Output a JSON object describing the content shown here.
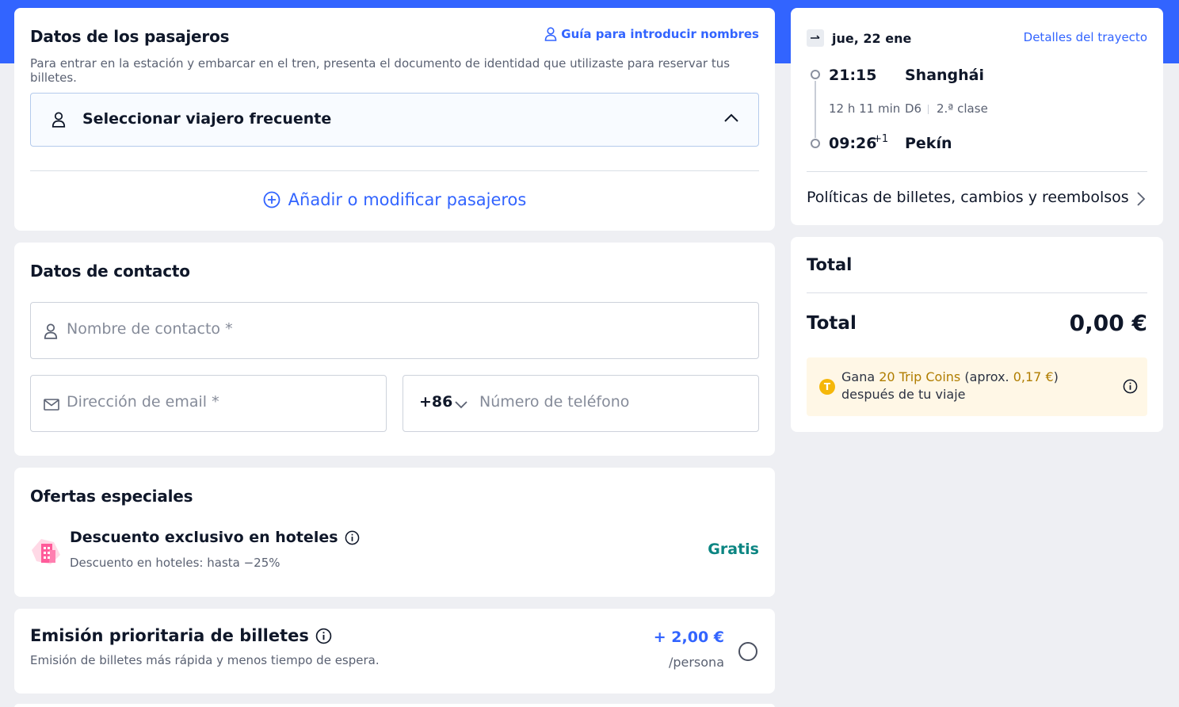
{
  "passengers": {
    "title": "Datos de los pasajeros",
    "guide_link": "Guía para introducir nombres",
    "subtitle": "Para entrar en la estación y embarcar en el tren, presenta el documento de identidad que utilizaste para reservar tus billetes.",
    "frequent_traveler": "Seleccionar viajero frecuente",
    "add_modify": "Añadir o modificar pasajeros"
  },
  "contact": {
    "title": "Datos de contacto",
    "name_placeholder": "Nombre de contacto *",
    "email_placeholder": "Dirección de email *",
    "country_code": "+86",
    "phone_placeholder": "Número de teléfono"
  },
  "offers": {
    "title": "Ofertas especiales",
    "hotel_title": "Descuento exclusivo en hoteles",
    "hotel_sub": "Descuento en hoteles: hasta −25%",
    "hotel_price": "Gratis"
  },
  "priority": {
    "title": "Emisión prioritaria de billetes",
    "sub": "Emisión de billetes más rápida y menos tiempo de espera.",
    "price": "+ 2,00 €",
    "per": "/persona"
  },
  "trip": {
    "date": "jue, 22 ene",
    "details_link": "Detalles del trayecto",
    "depart_time": "21:15",
    "depart_station": "Shanghái",
    "duration": "12 h 11 min",
    "train": "D6",
    "class": "2.ª clase",
    "arrive_time": "09:26",
    "arrive_day_offset": "+1",
    "arrive_station": "Pekín",
    "policies": "Políticas de billetes, cambios y reembolsos"
  },
  "total": {
    "heading": "Total",
    "label": "Total",
    "amount": "0,00 €",
    "coins_gana": "Gana",
    "coins_amount": "20 Trip Coins",
    "coins_aprox": "(aprox.",
    "coins_value": "0,17 €",
    "coins_rest": ") después de tu viaje"
  },
  "colors": {
    "brand_blue": "#3264ff",
    "free_green": "#0b8582",
    "coin_gold": "#f5b70a"
  },
  "icons": [
    "user-icon",
    "chevron-up-icon",
    "plus-circle-icon",
    "mail-icon",
    "chevron-down-icon",
    "hotel-icon",
    "info-icon",
    "train-icon",
    "chevron-right-icon",
    "coin-icon"
  ]
}
